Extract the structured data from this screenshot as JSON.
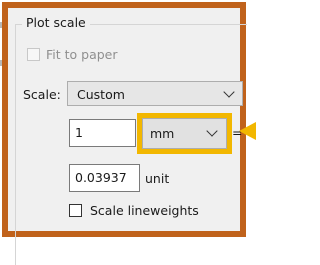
{
  "plot_scale": {
    "group_title": "Plot scale",
    "fit_to_paper": {
      "label": "Fit to paper",
      "checked": false,
      "enabled": false
    },
    "scale": {
      "label": "Scale:",
      "selected": "Custom"
    },
    "units_value": "1",
    "paper_unit": {
      "selected": "mm",
      "equals": "="
    },
    "drawing_units_value": "0.03937",
    "drawing_unit_label": "unit",
    "scale_lineweights": {
      "label": "Scale lineweights",
      "checked": false
    }
  },
  "colors": {
    "frame_highlight": "#c0621b",
    "callout_highlight": "#f2b700"
  }
}
